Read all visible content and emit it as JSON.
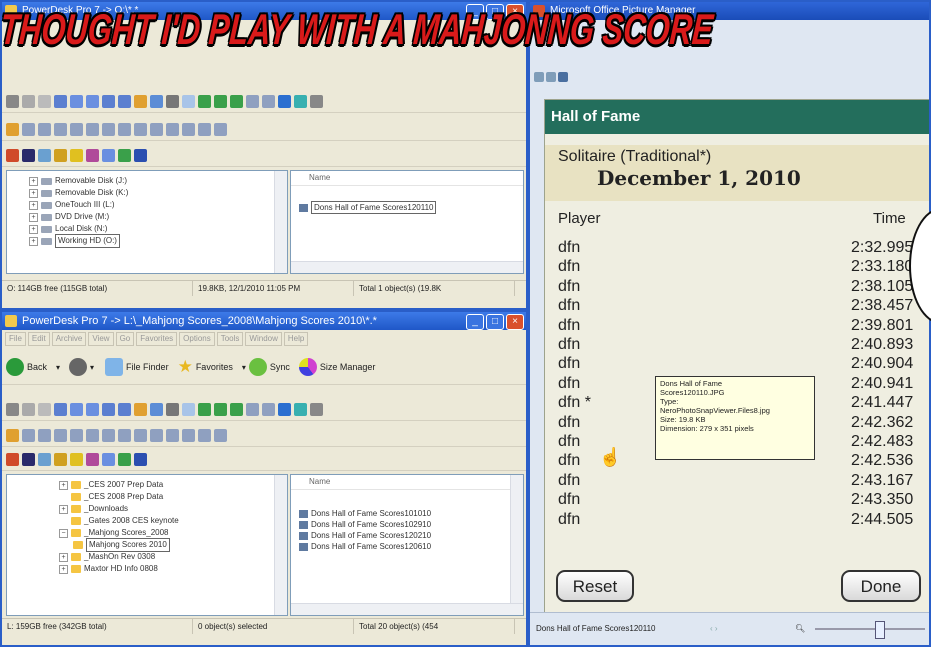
{
  "headline": "THOUGHT I'D PLAY WITH A MAHJONNG SCORE",
  "top_window": {
    "title": "PowerDesk Pro 7 -> O:\\*.*",
    "tree": [
      "Removable Disk (J:)",
      "Removable Disk (K:)",
      "OneTouch III (L:)",
      "DVD Drive (M:)",
      "Local Disk (N:)",
      "Working HD (O:)"
    ],
    "list_header": "Name",
    "files": [
      "Dons Hall of Fame Scores120110"
    ],
    "status": [
      "O: 114GB free (115GB total)",
      "19.8KB, 12/1/2010 11:05 PM",
      "Total 1 object(s) (19.8K"
    ]
  },
  "bottom_window": {
    "title": "PowerDesk Pro 7 -> L:\\_Mahjong Scores_2008\\Mahjong Scores 2010\\*.*",
    "menu": [
      "File",
      "Edit",
      "Archive",
      "View",
      "Go",
      "Favorites",
      "Options",
      "Tools",
      "Window",
      "Help"
    ],
    "nav": {
      "back": "Back",
      "file_finder": "File Finder",
      "favorites": "Favorites",
      "sync": "Sync",
      "size_manager": "Size Manager"
    },
    "tree": [
      "_CES 2007 Prep Data",
      "_CES 2008 Prep Data",
      "_Downloads",
      "_Gates 2008 CES keynote",
      "_Mahjong Scores_2008",
      "Mahjong Scores 2010",
      "_MashOn Rev 0308",
      "Maxtor HD Info 0808"
    ],
    "list_header": "Name",
    "files": [
      "Dons Hall of Fame Scores101010",
      "Dons Hall of Fame Scores102910",
      "Dons Hall of Fame Scores120210",
      "Dons Hall of Fame Scores120610"
    ],
    "status": [
      "L: 159GB free (342GB total)",
      "0 object(s) selected",
      "Total 20 object(s) (454"
    ]
  },
  "picture_manager": {
    "title": "Microsoft Office Picture Manager",
    "hof": {
      "title": "Hall of Fame",
      "game": "Solitaire (Traditional*)",
      "date": "December 1, 2010",
      "col_player": "Player",
      "col_time": "Time",
      "rows": [
        {
          "player": "dfn",
          "time": "2:32.995"
        },
        {
          "player": "dfn",
          "time": "2:33.180"
        },
        {
          "player": "dfn",
          "time": "2:38.105"
        },
        {
          "player": "dfn",
          "time": "2:38.457"
        },
        {
          "player": "dfn",
          "time": "2:39.801"
        },
        {
          "player": "dfn",
          "time": "2:40.893"
        },
        {
          "player": "dfn",
          "time": "2:40.904"
        },
        {
          "player": "dfn",
          "time": "2:40.941"
        },
        {
          "player": "dfn *",
          "time": "2:41.447"
        },
        {
          "player": "dfn",
          "time": "2:42.362"
        },
        {
          "player": "dfn",
          "time": "2:42.483"
        },
        {
          "player": "dfn",
          "time": "2:42.536"
        },
        {
          "player": "dfn",
          "time": "2:43.167"
        },
        {
          "player": "dfn",
          "time": "2:43.350"
        },
        {
          "player": "dfn",
          "time": "2:44.505"
        }
      ],
      "reset": "Reset",
      "done": "Done"
    },
    "tooltip": [
      "Dons Hall of Fame",
      "Scores120110.JPG",
      "Type:",
      "NeroPhotoSnapViewer.Files8.jpg",
      "Size: 19.8 KB",
      "Dimension: 279 x 351 pixels"
    ],
    "status_file": "Dons Hall of Fame Scores120110"
  }
}
